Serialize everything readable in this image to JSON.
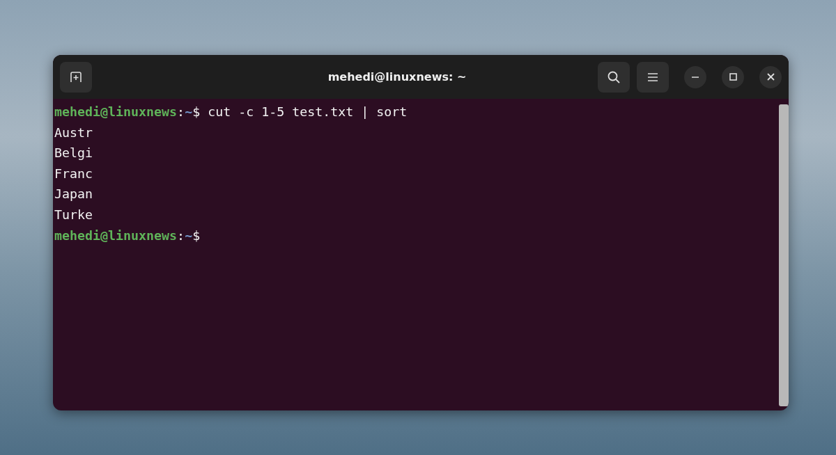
{
  "window": {
    "title": "mehedi@linuxnews: ~"
  },
  "terminal": {
    "lines": [
      {
        "kind": "prompt",
        "user_host": "mehedi@linuxnews",
        "separator": ":",
        "path": "~",
        "symbol": "$",
        "command": "cut -c 1-5 test.txt | sort"
      },
      {
        "kind": "output",
        "text": "Austr"
      },
      {
        "kind": "output",
        "text": "Belgi"
      },
      {
        "kind": "output",
        "text": "Franc"
      },
      {
        "kind": "output",
        "text": "Japan"
      },
      {
        "kind": "output",
        "text": "Turke"
      },
      {
        "kind": "prompt",
        "user_host": "mehedi@linuxnews",
        "separator": ":",
        "path": "~",
        "symbol": "$"
      }
    ]
  }
}
